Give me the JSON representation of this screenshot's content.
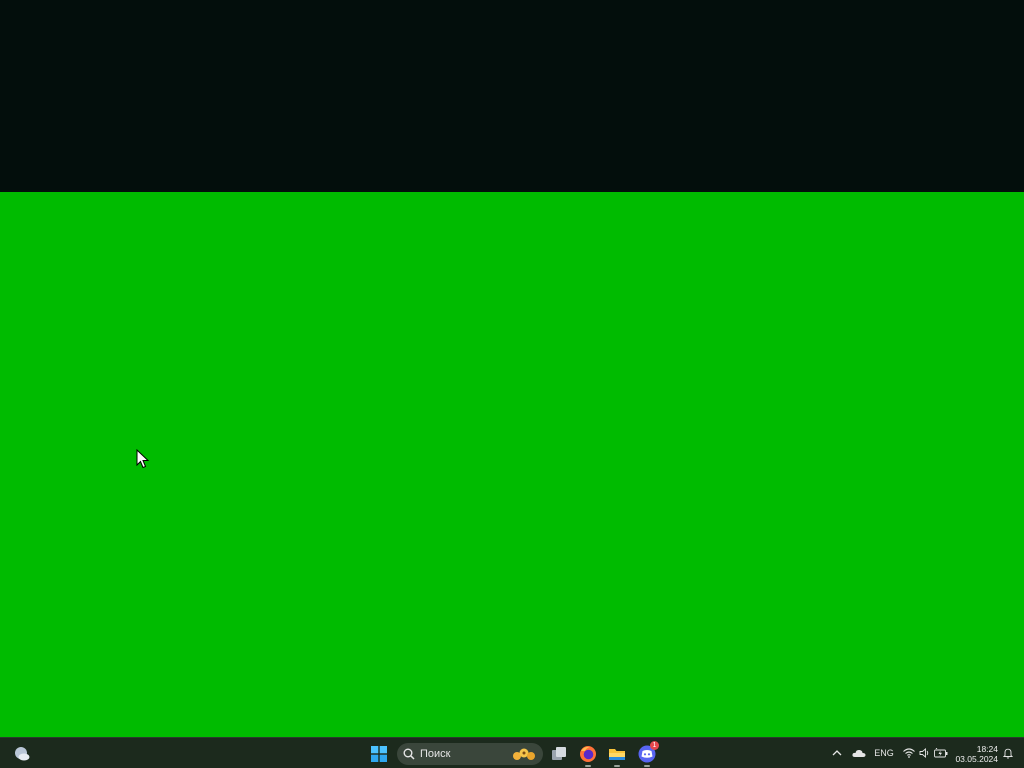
{
  "desktop": {
    "top_band_color": "#030e0c",
    "background_color": "#00bb00"
  },
  "taskbar": {
    "background_color": "#1c2a1d",
    "weather_icon": "weather-icon",
    "start_icon": "windows-start-icon",
    "search": {
      "placeholder": "Поиск",
      "icon": "search-icon"
    },
    "apps": [
      {
        "name": "task-view",
        "icon": "task-view-icon"
      },
      {
        "name": "firefox",
        "icon": "firefox-icon",
        "running": true
      },
      {
        "name": "file-explorer",
        "icon": "folder-icon",
        "running": true
      },
      {
        "name": "discord",
        "icon": "discord-icon",
        "running": true,
        "badge": "1"
      }
    ],
    "tray": {
      "chevron_icon": "chevron-up-icon",
      "onedrive_icon": "cloud-icon",
      "language": "ENG",
      "wifi_icon": "wifi-icon",
      "volume_icon": "volume-icon",
      "battery_icon": "battery-icon",
      "notification_icon": "bell-icon"
    },
    "clock": {
      "time": "18:24",
      "date": "03.05.2024"
    }
  }
}
